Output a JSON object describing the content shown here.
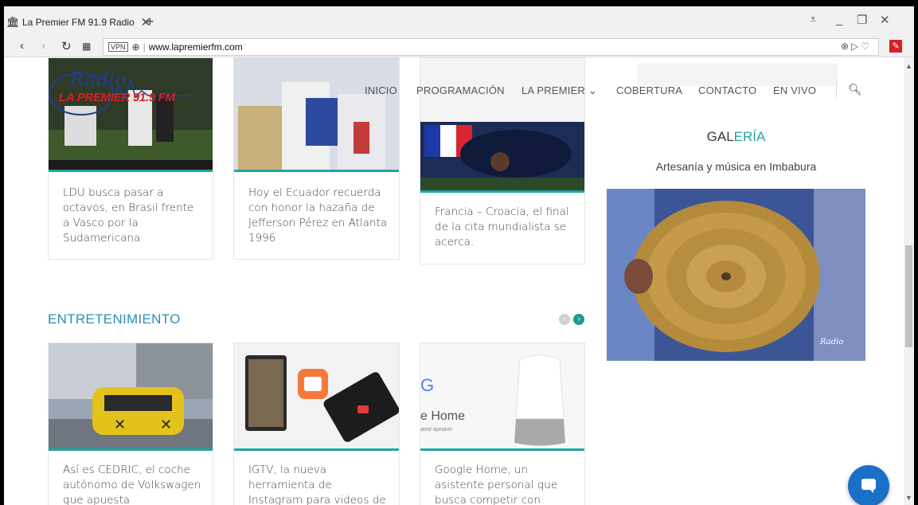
{
  "browser": {
    "tab_title": "La Premier FM 91.9 Radio",
    "url": "www.lapremierfm.com",
    "vpn_label": "VPN"
  },
  "site": {
    "logo_text_1": "Radio",
    "logo_text_2": "LA PREMIER 91.9 FM",
    "menu": [
      "INICIO",
      "PROGRAMACIÓN",
      "LA PREMIER ⌄",
      "COBERTURA",
      "CONTACTO",
      "EN VIVO"
    ]
  },
  "top_cards": [
    {
      "title": "LDU busca pasar a octavos, en Brasil frente a Vasco por la Sudamericana"
    },
    {
      "title": "Hoy el Ecuador recuerda con honor la hazaña de Jefferson Pérez en Atlanta 1996"
    },
    {
      "title": "Francia – Croacia, el final de la cita mundialista se acerca."
    }
  ],
  "section": {
    "title": "ENTRETENIMIENTO"
  },
  "bottom_cards": [
    {
      "title": "Así es CEDRIC, el coche autónomo de Volkswagen que apuesta"
    },
    {
      "title": "IGTV, la nueva herramienta de Instagram para videos de"
    },
    {
      "title": "Google Home, un asistente personal que busca competir con"
    }
  ],
  "gallery": {
    "title_a": "GAL",
    "title_b": "ERÍA",
    "subtitle": "Artesanía y música en Imbabura"
  },
  "colors": {
    "accent": "#20a6a0",
    "section": "#2a8fb8",
    "chat": "#1a6fc7"
  }
}
